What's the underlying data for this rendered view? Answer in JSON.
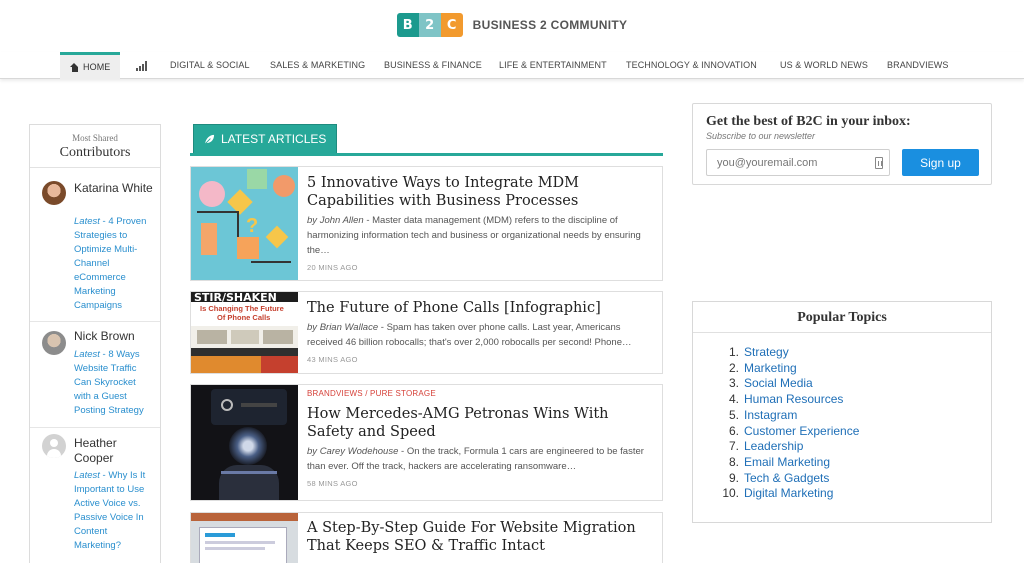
{
  "brand": {
    "logo_letters": [
      "B",
      "2",
      "C"
    ],
    "name": "BUSINESS 2 COMMUNITY"
  },
  "nav": {
    "home": "HOME",
    "items": [
      "DIGITAL & SOCIAL",
      "SALES & MARKETING",
      "BUSINESS & FINANCE",
      "LIFE & ENTERTAINMENT",
      "TECHNOLOGY & INNOVATION",
      "US & WORLD NEWS",
      "BRANDVIEWS"
    ]
  },
  "contributors": {
    "small_heading": "Most Shared",
    "title": "Contributors",
    "items": [
      {
        "name": "Katarina White",
        "latest_label": "Latest",
        "latest_title": "4 Proven Strategies to Optimize Multi-Channel eCommerce Marketing Campaigns"
      },
      {
        "name": "Nick Brown",
        "latest_label": "Latest",
        "latest_title": "8 Ways Website Traffic Can Skyrocket with a Guest Posting Strategy"
      },
      {
        "name": "Heather Cooper",
        "latest_label": "Latest",
        "latest_title": "Why Is It Important to Use Active Voice vs. Passive Voice In Content Marketing?"
      }
    ]
  },
  "latest": {
    "tab_label": "LATEST ARTICLES",
    "articles": [
      {
        "kicker": "",
        "title": "5 Innovative Ways to Integrate MDM Capabilities with Business Processes",
        "by": "by",
        "author": "John Allen",
        "excerpt": " - Master data management (MDM) refers to the discipline of harmonizing information tech and business or organizational needs by ensuring the…",
        "time": "20 MINS AGO"
      },
      {
        "kicker": "",
        "title": "The Future of Phone Calls [Infographic]",
        "by": "by",
        "author": "Brian Wallace",
        "excerpt": " - Spam has taken over phone calls. Last year, Americans received 46 billion robocalls; that's over 2,000 robocalls per second! Phone…",
        "time": "43 MINS AGO"
      },
      {
        "kicker": "BRANDVIEWS / PURE STORAGE",
        "title": "How Mercedes-AMG Petronas Wins With Safety and Speed",
        "by": "by",
        "author": "Carey Wodehouse",
        "excerpt": " - On the track, Formula 1 cars are engineered to be faster than ever. Off the track, hackers are accelerating ransomware…",
        "time": "58 MINS AGO"
      },
      {
        "kicker": "",
        "title": "A Step-By-Step Guide For Website Migration That Keeps SEO & Traffic Intact",
        "by": "",
        "author": "",
        "excerpt": "",
        "time": ""
      }
    ],
    "thumb2_text": {
      "line1": "STIR/SHAKEN",
      "line2": "Is Changing The Future",
      "line3": "Of Phone Calls"
    }
  },
  "newsletter": {
    "title": "Get the best of B2C in your inbox:",
    "subtitle": "Subscribe to our newsletter",
    "placeholder": "you@youremail.com",
    "button": "Sign up"
  },
  "popular_topics": {
    "title": "Popular Topics",
    "items": [
      "Strategy",
      "Marketing",
      "Social Media",
      "Human Resources",
      "Instagram",
      "Customer Experience",
      "Leadership",
      "Email Marketing",
      "Tech & Gadgets",
      "Digital Marketing"
    ]
  },
  "colors": {
    "accent_teal": "#27a899",
    "link_blue": "#1f6fb7",
    "button_blue": "#1a8fe0",
    "kicker_red": "#d6423a",
    "logo_orange": "#f29a2e"
  }
}
